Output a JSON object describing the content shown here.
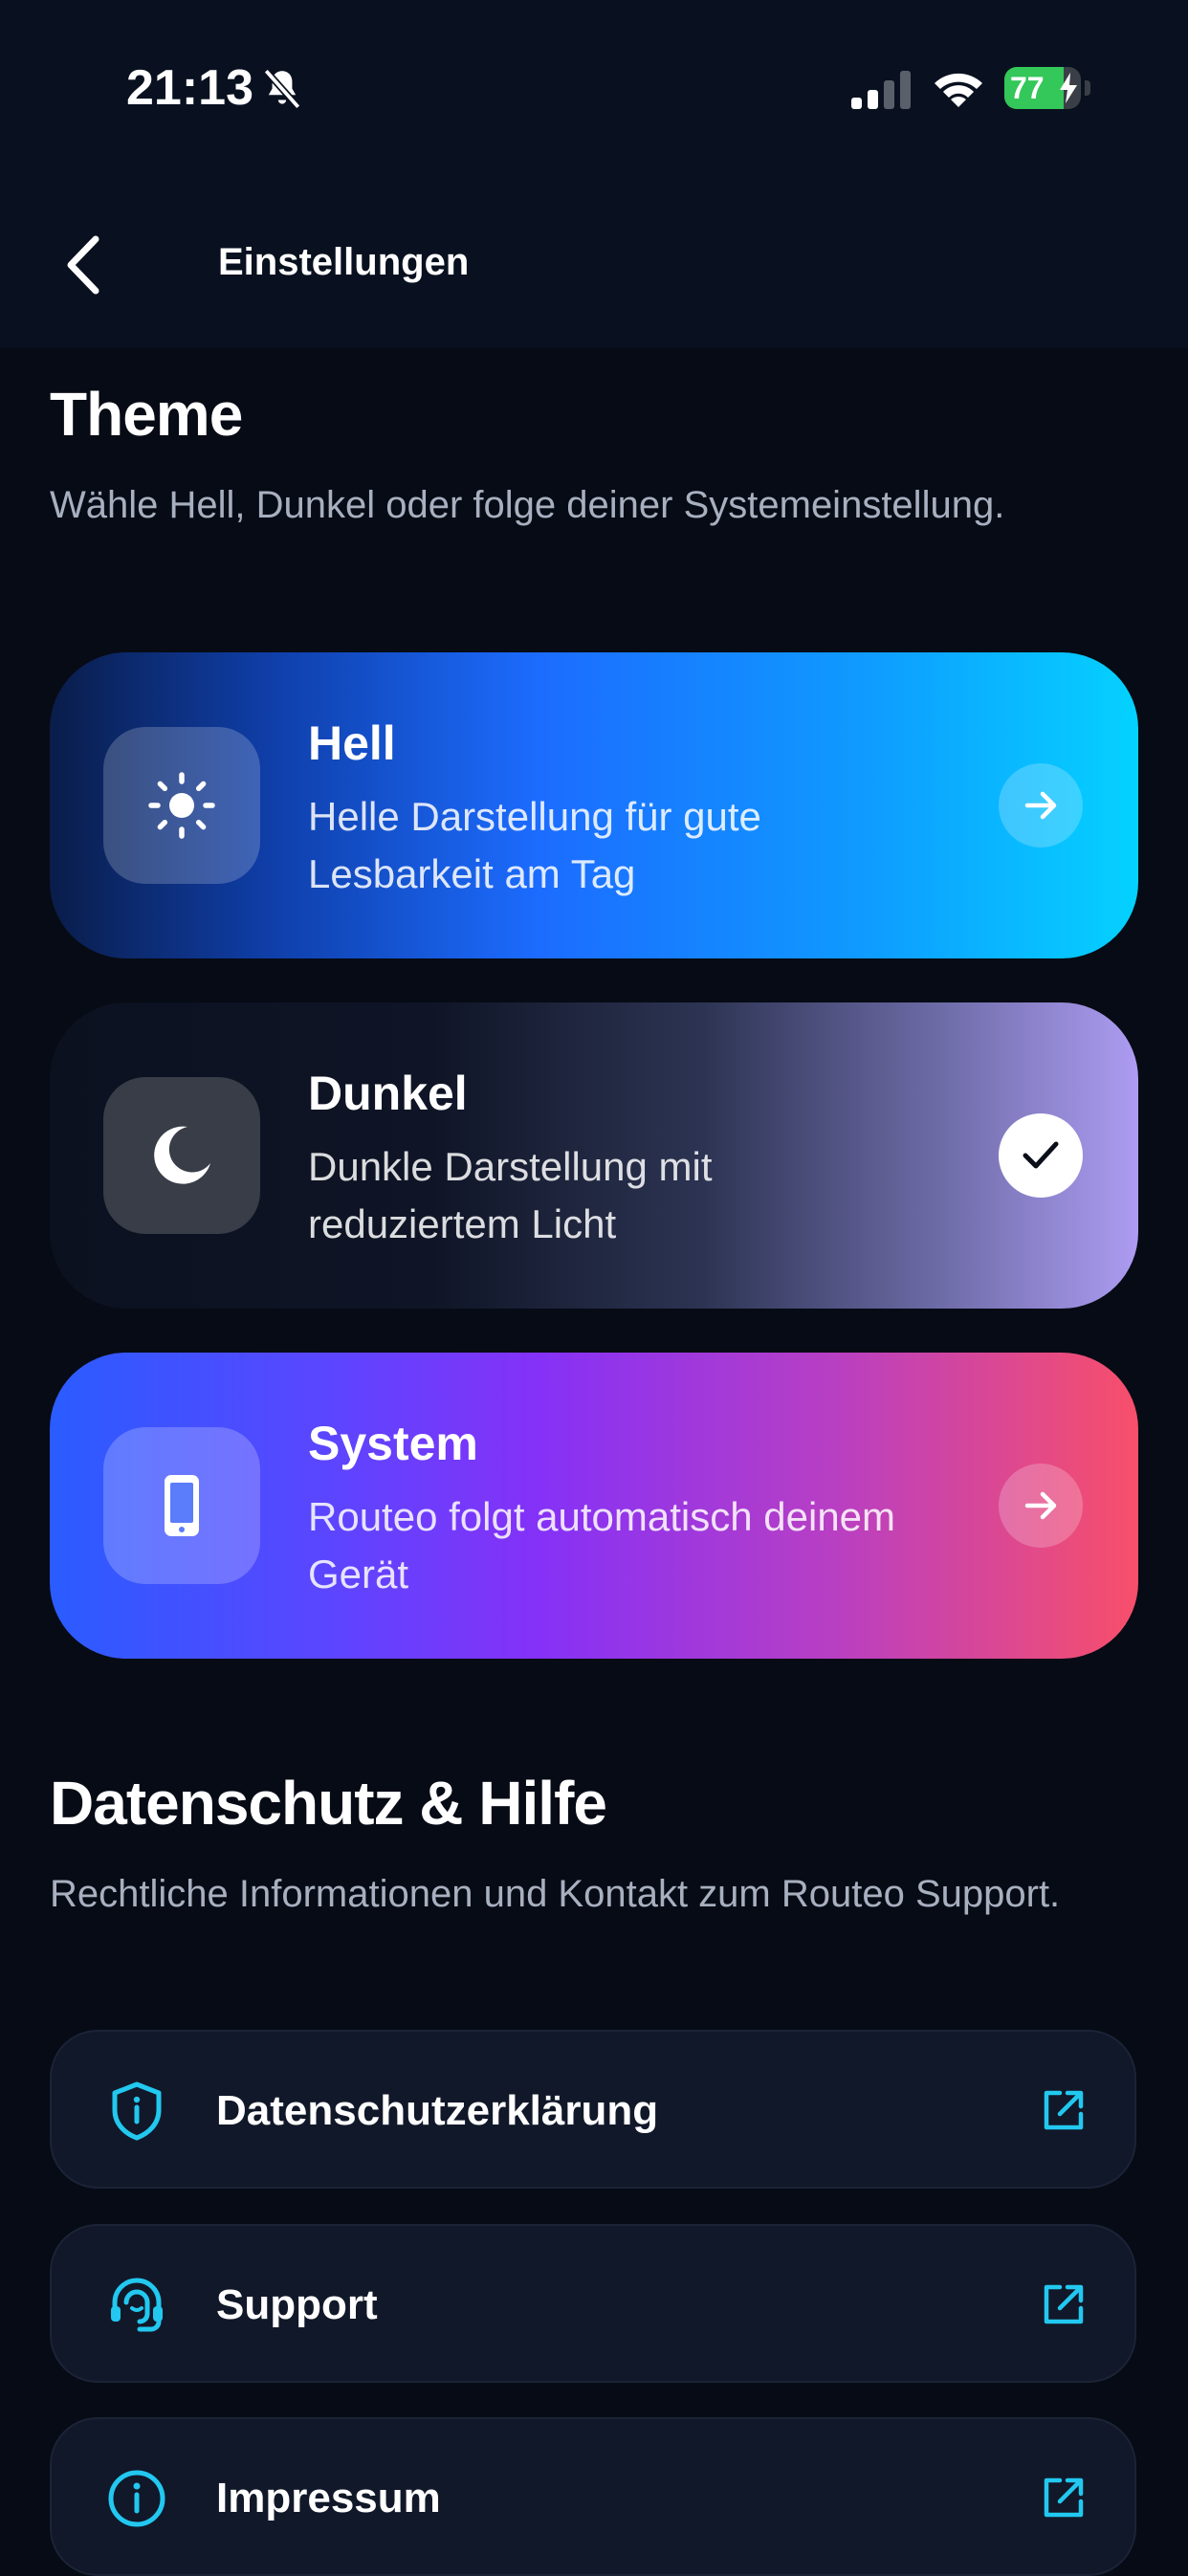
{
  "status_bar": {
    "time": "21:13",
    "battery_percent": "77",
    "battery_level": 0.77,
    "battery_color": "#34c759"
  },
  "nav": {
    "title": "Einstellungen",
    "back_icon": "chevron-left-icon"
  },
  "theme_section": {
    "title": "Theme",
    "description": "Wähle Hell, Dunkel oder folge deiner Systemeinstellung.",
    "options": [
      {
        "title": "Hell",
        "description": "Helle Darstellung für gute Lesbarkeit am Tag",
        "icon": "sun-icon",
        "selected": false
      },
      {
        "title": "Dunkel",
        "description": "Dunkle Darstellung mit reduziertem Licht",
        "icon": "moon-icon",
        "selected": true
      },
      {
        "title": "System",
        "description": "Routeo folgt automatisch deinem Gerät",
        "icon": "phone-icon",
        "selected": false
      }
    ]
  },
  "privacy_section": {
    "title": "Datenschutz & Hilfe",
    "description": "Rechtliche Informationen und Kontakt zum Routeo Support.",
    "links": [
      {
        "label": "Datenschutzerklärung",
        "icon": "shield-info-icon"
      },
      {
        "label": "Support",
        "icon": "headset-icon"
      },
      {
        "label": "Impressum",
        "icon": "info-circle-icon"
      }
    ],
    "accent_color": "#22c8f0"
  }
}
